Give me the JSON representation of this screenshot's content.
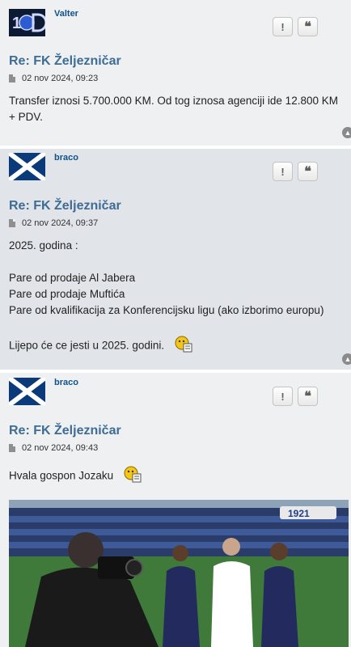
{
  "posts": [
    {
      "username": "Valter",
      "title": "Re: FK Željezničar",
      "date": "02 nov 2024, 09:23",
      "body": [
        "Transfer iznosi 5.700.000 KM. Od tog iznosa agenciji ide 12.800 KM",
        "+ PDV."
      ]
    },
    {
      "username": "braco",
      "title": "Re: FK Željezničar",
      "date": "02 nov 2024, 09:37",
      "body": [
        "2025. godina :",
        "",
        "Pare od prodaje Al Jabera",
        "Pare od prodaje Muftića",
        "Pare od kvalifikacija za Konferencijsku ligu (ako izborimo europu)",
        "",
        "Lijepo će ce jesti u 2025. godini."
      ]
    },
    {
      "username": "braco",
      "title": "Re: FK Željezničar",
      "date": "02 nov 2024, 09:43",
      "body": [
        "Hvala gospon Jozaku"
      ]
    }
  ],
  "buttons": {
    "report_icon": "!",
    "quote_icon": "❝"
  },
  "icons": [
    "report-icon",
    "quote-icon",
    "post-icon",
    "back-to-top-icon",
    "smiley-icon"
  ],
  "photo_badge": "1921"
}
